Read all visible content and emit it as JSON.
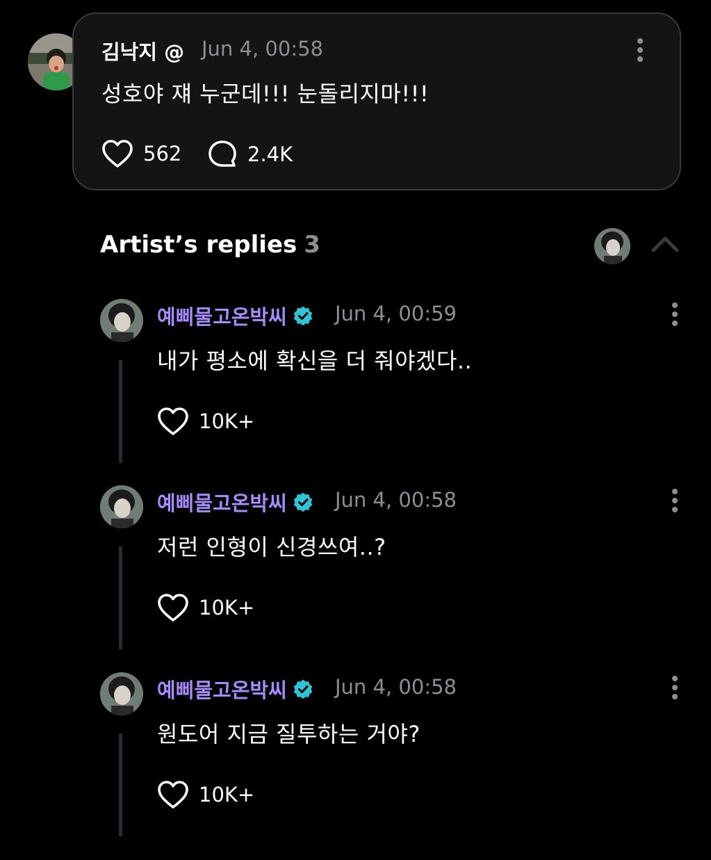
{
  "post": {
    "author": "김낙지 @",
    "time": "Jun 4, 00:58",
    "text": "성호야 쟤 누군데!!! 눈돌리지마!!!",
    "likes": "562",
    "comments": "2.4K",
    "icons": [
      "avatar",
      "more-vertical-icon",
      "heart-icon",
      "comment-bubble-icon"
    ]
  },
  "artist_replies": {
    "title": "Artist’s replies",
    "count": "3",
    "icons": [
      "artist-avatar",
      "chevron-up-icon"
    ]
  },
  "replies": [
    {
      "author": "예삐물고온박씨",
      "time": "Jun 4, 00:59",
      "text": "내가 평소에 확신을 더 줘야겠다..",
      "likes": "10K+"
    },
    {
      "author": "예삐물고온박씨",
      "time": "Jun 4, 00:58",
      "text": "저런 인형이 신경쓰여..?",
      "likes": "10K+"
    },
    {
      "author": "예삐물고온박씨",
      "time": "Jun 4, 00:58",
      "text": "원도어 지금 질투하는 거야?",
      "likes": "10K+"
    }
  ],
  "colors": {
    "background": "#000000",
    "card_background": "#141414",
    "card_border": "#3a3a3c",
    "artist_name": "#a78bfa",
    "verified_badge": "#2ec4d6",
    "secondary_text": "#8e8e93"
  }
}
